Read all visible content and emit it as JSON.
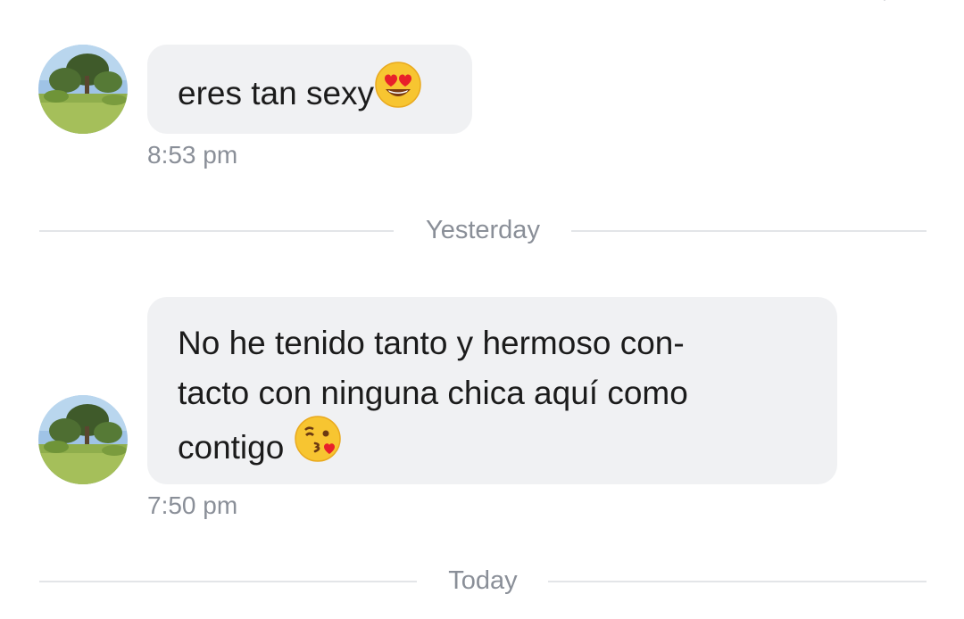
{
  "conversation": {
    "messages": [
      {
        "lines": [
          "eres tan sexy"
        ],
        "emoji": "heart-eyes-emoji",
        "time": "8:53 pm"
      },
      {
        "lines": [
          "No he tenido tanto y hermoso con-",
          "tacto con ninguna chica aquí como",
          "contigo "
        ],
        "emoji": "kissing-heart-emoji",
        "time": "7:50 pm"
      }
    ],
    "dividers": [
      "Yesterday",
      "Today"
    ]
  },
  "colors": {
    "bubble_background": "#f0f1f3",
    "timestamp_text": "#8a8f98",
    "divider_line": "#e3e5e8"
  }
}
